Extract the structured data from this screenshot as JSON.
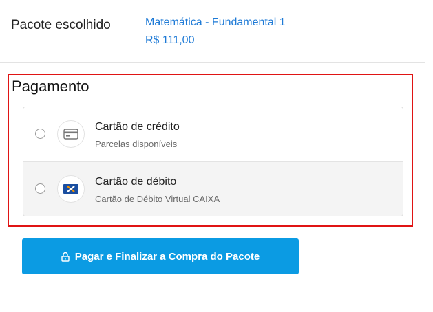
{
  "package": {
    "label": "Pacote escolhido",
    "name": "Matemática - Fundamental 1",
    "price": "R$ 111,00"
  },
  "payment": {
    "title": "Pagamento",
    "options": [
      {
        "title": "Cartão de crédito",
        "subtitle": "Parcelas disponíveis",
        "icon": "credit-card-icon",
        "selected": false
      },
      {
        "title": "Cartão de débito",
        "subtitle": "Cartão de Débito Virtual CAIXA",
        "icon": "caixa-logo-icon",
        "selected": false
      }
    ]
  },
  "button": {
    "label": "Pagar e Finalizar a Compra do Pacote",
    "icon": "lock-icon"
  },
  "colors": {
    "link_blue": "#1e7ad6",
    "button_blue": "#0b9be3",
    "highlight_red": "#e01414",
    "caixa_blue": "#1a4ea0",
    "caixa_orange": "#f39200"
  }
}
